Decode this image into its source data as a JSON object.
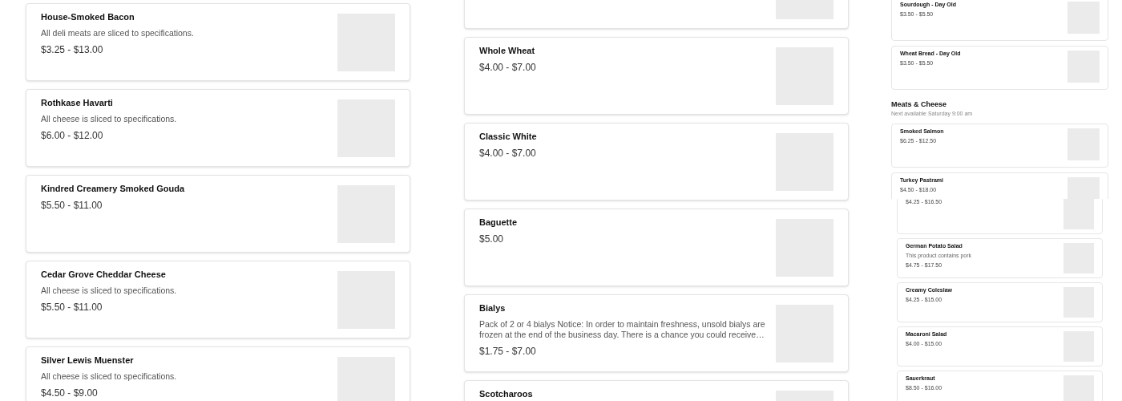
{
  "left_column": {
    "items": [
      {
        "name": "House-Smoked Bacon",
        "description": "All deli meats are sliced to specifications.",
        "price": "$3.25 - $13.00"
      },
      {
        "name": "Rothkase Havarti",
        "description": "All cheese is sliced to specifications.",
        "price": "$6.00 - $12.00"
      },
      {
        "name": "Kindred Creamery Smoked Gouda",
        "price": "$5.50 - $11.00"
      },
      {
        "name": "Cedar Grove Cheddar Cheese",
        "description": "All cheese is sliced to specifications.",
        "price": "$5.50 - $11.00"
      },
      {
        "name": "Silver Lewis Muenster",
        "description": "All cheese is sliced to specifications.",
        "price": "$4.50 - $9.00"
      }
    ]
  },
  "middle_column": {
    "cut_off_card_above": true,
    "items": [
      {
        "name": "Whole Wheat",
        "price": "$4.00 - $7.00"
      },
      {
        "name": "Classic White",
        "price": "$4.00 - $7.00"
      },
      {
        "name": "Baguette",
        "price": "$5.00"
      },
      {
        "name": "Bialys",
        "description": "Pack of 2 or 4 bialys Notice: In order to maintain freshness, unsold bialys are frozen at the end of the business day. There is a chance you could receive…",
        "price": "$1.75 - $7.00"
      },
      {
        "name": "Scotcharoos"
      }
    ]
  },
  "preview_top": {
    "items": [
      {
        "name": "Sourdough - Day Old",
        "price": "$3.50 - $5.50"
      },
      {
        "name": "Wheat Bread - Day Old",
        "price": "$3.50 - $5.50"
      }
    ],
    "section": {
      "title": "Meats & Cheese",
      "subtitle": "Next available Saturday 9:00 am",
      "items": [
        {
          "name": "Smoked Salmon",
          "price": "$6.25 - $12.50"
        },
        {
          "name": "Turkey Pastrami",
          "price": "$4.50 - $18.00"
        }
      ]
    }
  },
  "preview_bottom": {
    "items": [
      {
        "price": "$4.25 - $16.50"
      },
      {
        "name": "German Potato Salad",
        "description": "This product contains pork",
        "price": "$4.75 - $17.50"
      },
      {
        "name": "Creamy Coleslaw",
        "price": "$4.25 - $15.00"
      },
      {
        "name": "Macaroni Salad",
        "price": "$4.00 - $15.00"
      },
      {
        "name": "Sauerkraut",
        "price": "$8.50 - $16.00"
      }
    ]
  }
}
